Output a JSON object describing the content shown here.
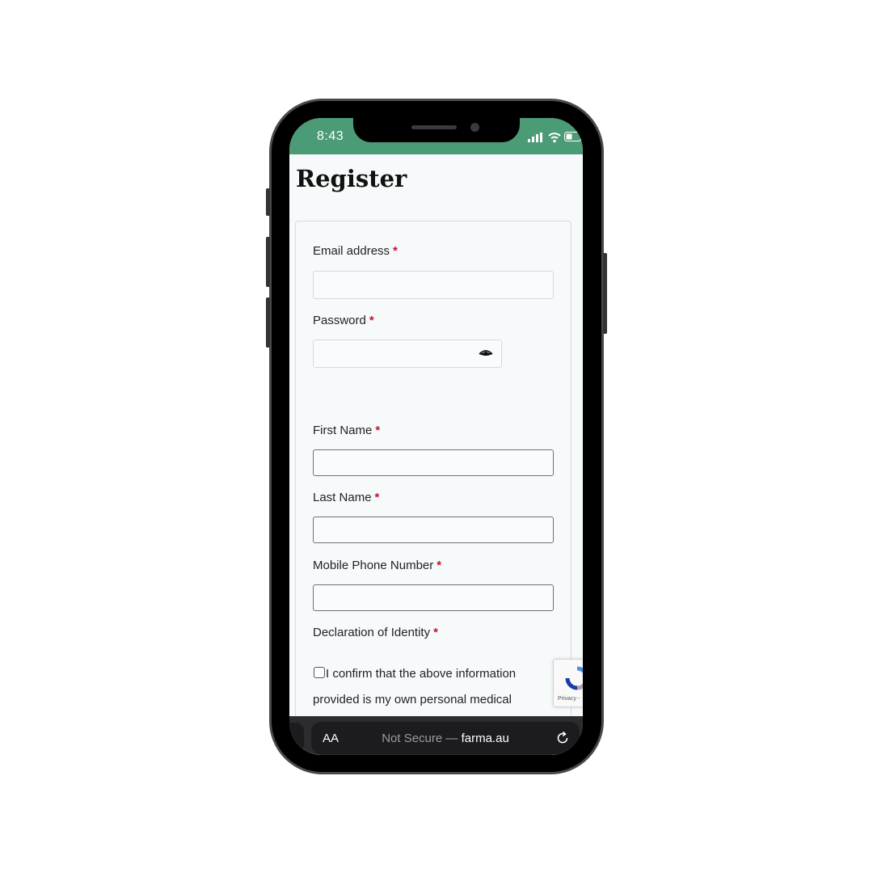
{
  "status_bar": {
    "time": "8:43",
    "background": "#4b9b77"
  },
  "page": {
    "title": "Register"
  },
  "form": {
    "email_label": "Email address",
    "password_label": "Password",
    "first_name_label": "First Name",
    "last_name_label": "Last Name",
    "mobile_label": "Mobile Phone Number",
    "declaration_label": "Declaration of Identity",
    "required_marker": "*",
    "confirm_text": "I confirm that the above information provided is my own personal medical",
    "email_value": "",
    "password_value": "",
    "first_name_value": "",
    "last_name_value": "",
    "mobile_value": "",
    "confirm_checked": false
  },
  "recaptcha": {
    "label": "Privacy -"
  },
  "browser": {
    "text_size_button": "AA",
    "security_text": "Not Secure —",
    "domain": "farma.au"
  },
  "colors": {
    "required": "#c4122f",
    "accent": "#4b9b77"
  },
  "icons": [
    "eye-icon",
    "reload-icon",
    "signal-icon",
    "wifi-icon",
    "battery-icon",
    "recaptcha-icon"
  ]
}
